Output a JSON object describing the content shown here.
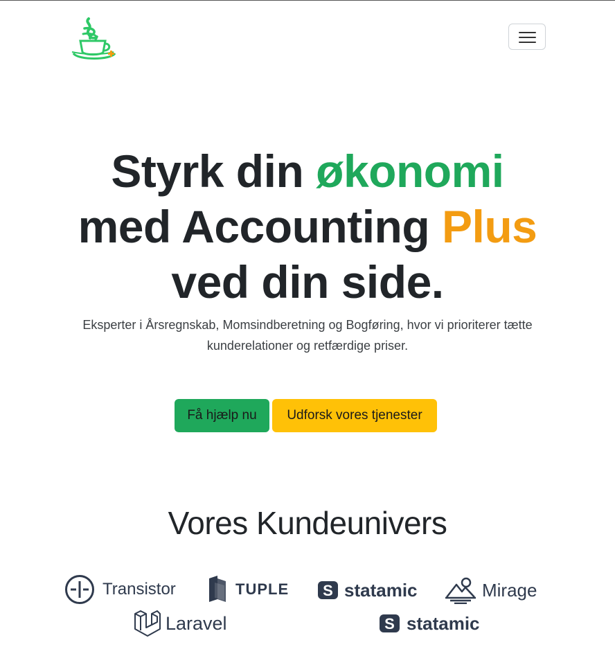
{
  "nav": {
    "logo_icon": "coffee-cup-logo",
    "menu_icon": "hamburger-menu-icon"
  },
  "hero": {
    "line1_a": "Styrk din ",
    "line1_b": "økonomi",
    "line2_a": "med Accounting ",
    "line2_b": "Plus",
    "line3": "ved din side.",
    "lead": "Eksperter i Årsregnskab, Momsindberetning og Bogføring, hvor vi prioriterer tætte kunderelationer og retfærdige priser.",
    "accent_green": "#1fa85b",
    "accent_orange": "#f39c12"
  },
  "buttons": {
    "help_label": "Få hjælp nu",
    "services_label": "Udforsk vores tjenester"
  },
  "customers": {
    "title": "Vores Kundeunivers",
    "logos": [
      "Transistor",
      "TUPLE",
      "statamic",
      "Mirage",
      "Laravel",
      "statamic"
    ]
  }
}
